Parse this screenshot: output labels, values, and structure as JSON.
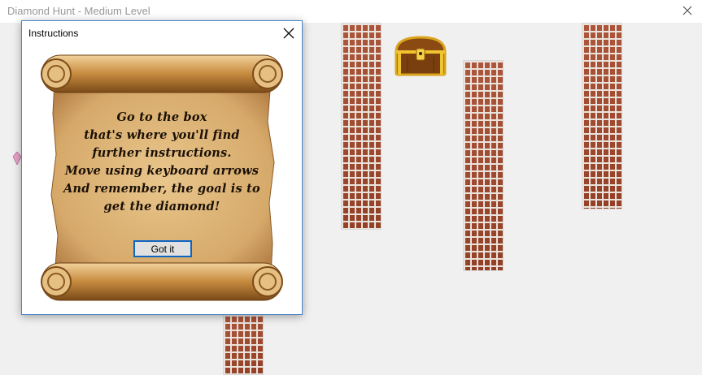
{
  "window": {
    "title": "Diamond Hunt - Medium Level"
  },
  "dialog": {
    "title": "Instructions",
    "message_lines": [
      "Go to the box",
      "that's where you'll find",
      "further instructions.",
      "Move using keyboard arrows",
      "And remember, the goal is to",
      "get the diamond!"
    ],
    "button_label": "Got it"
  },
  "icons": {
    "window_close": "close-icon",
    "dialog_close": "close-icon",
    "chest": "treasure-chest-icon",
    "player": "crystal-icon"
  },
  "colors": {
    "brick": "#a7482b",
    "mortar": "#e9e3dc",
    "dialog_border": "#4a86c8",
    "button_border": "#0f66c2",
    "background": "#f0f0f0"
  }
}
